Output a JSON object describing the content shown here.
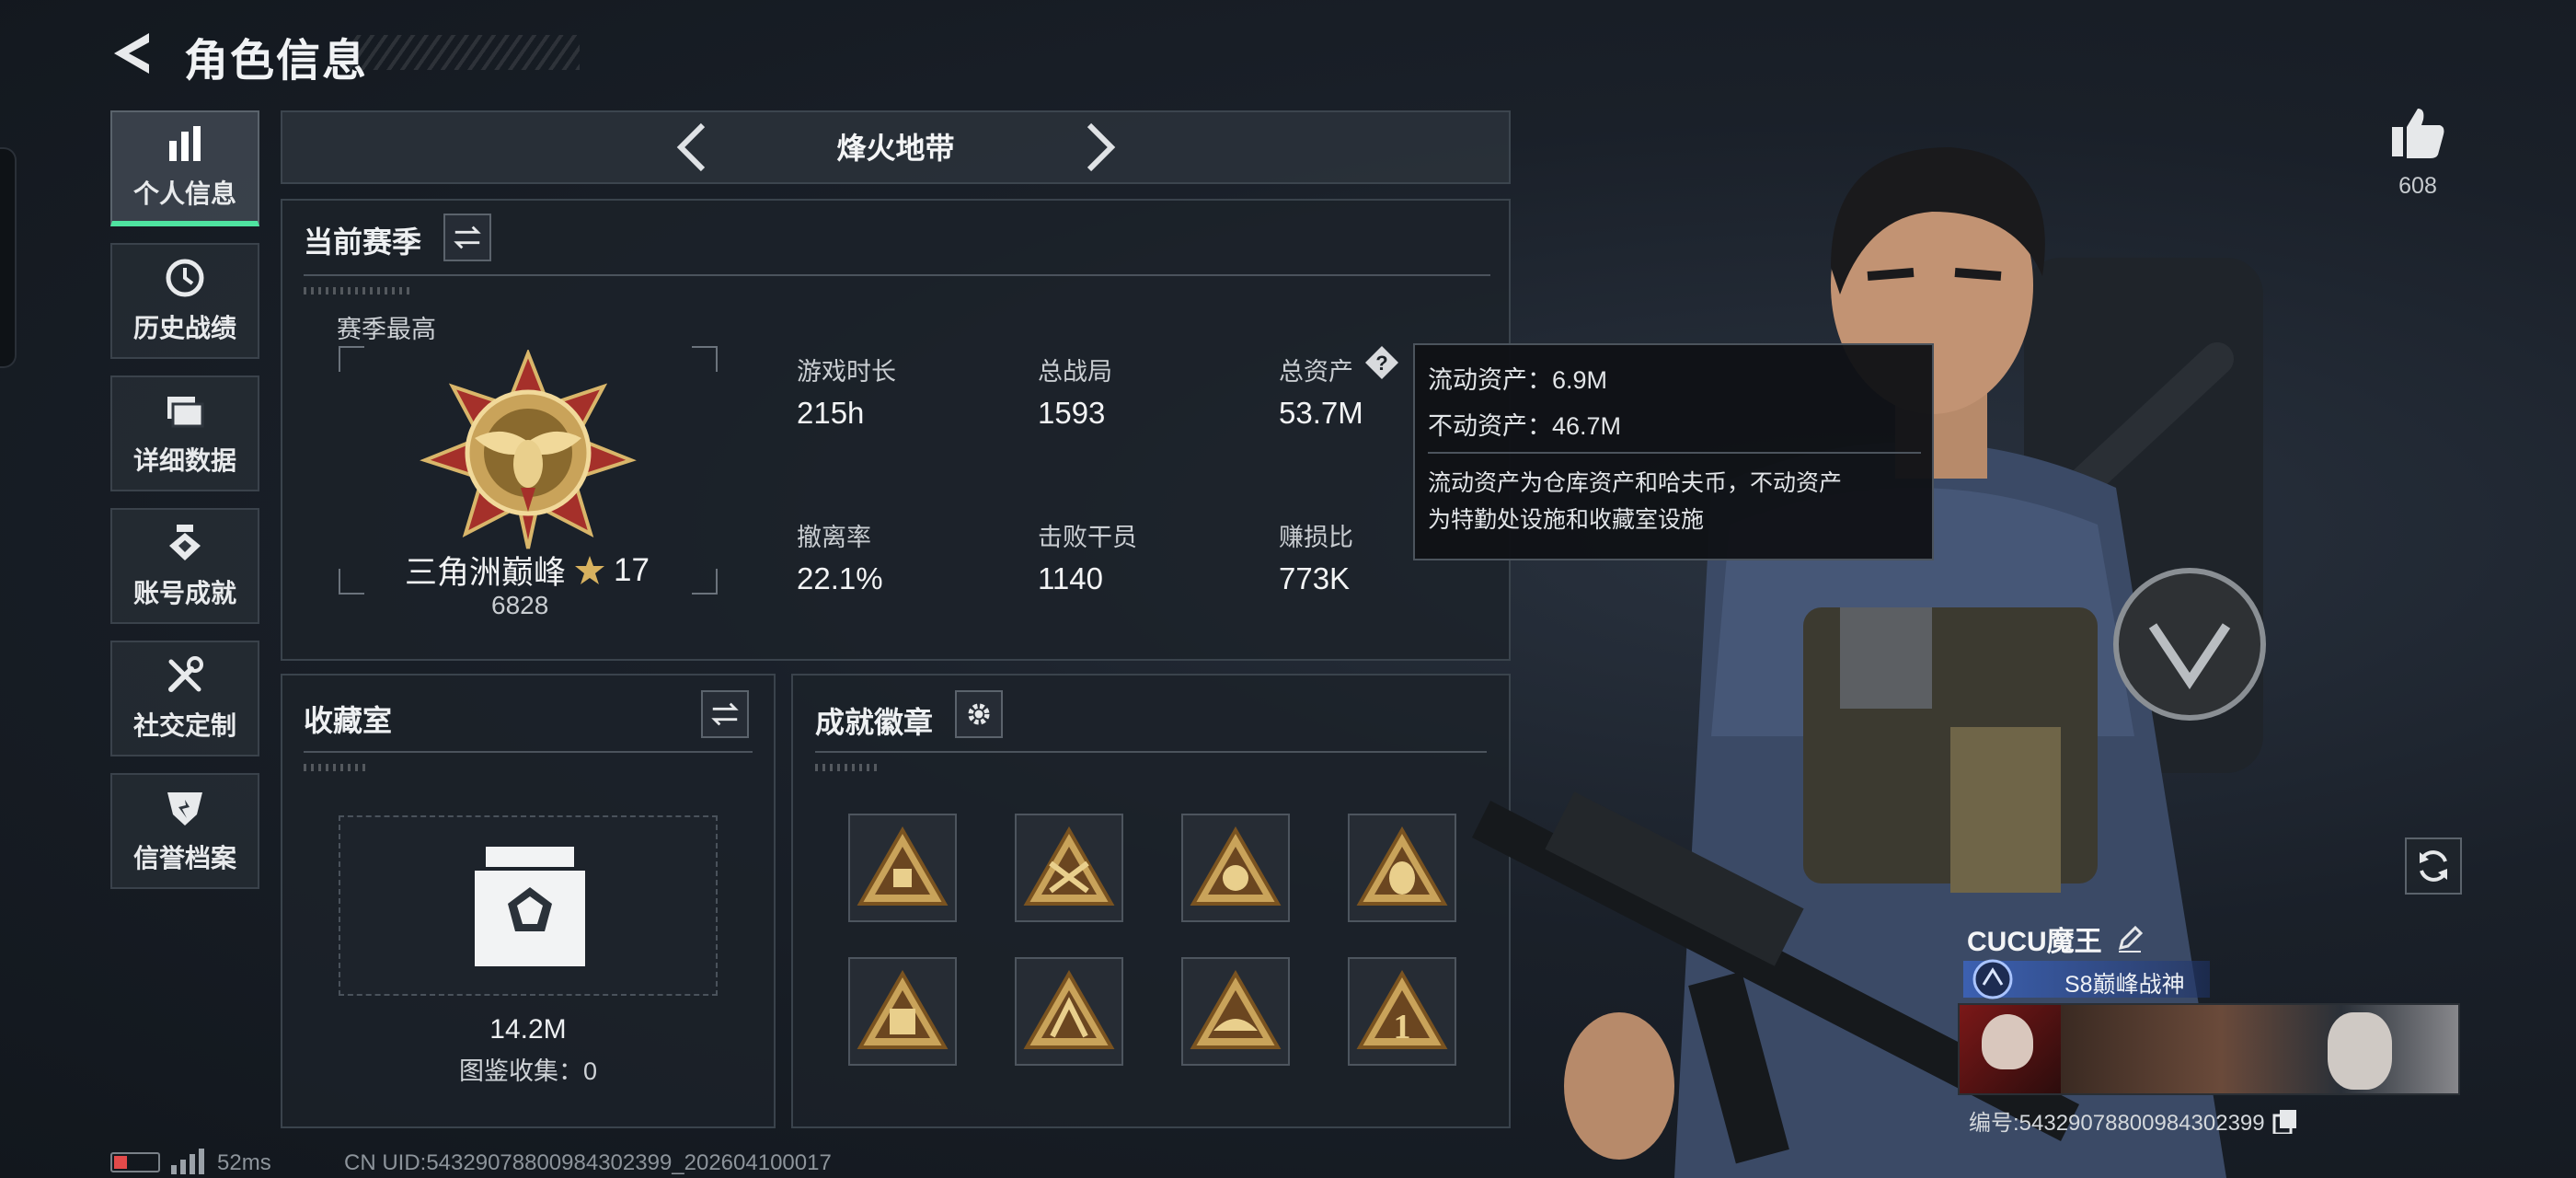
{
  "header": {
    "title": "角色信息"
  },
  "sidebar": {
    "items": [
      {
        "label": "个人信息",
        "icon": "bar-chart-icon",
        "active": true
      },
      {
        "label": "历史战绩",
        "icon": "history-icon",
        "active": false
      },
      {
        "label": "详细数据",
        "icon": "folder-icon",
        "active": false
      },
      {
        "label": "账号成就",
        "icon": "achievement-icon",
        "active": false
      },
      {
        "label": "社交定制",
        "icon": "tools-icon",
        "active": false
      },
      {
        "label": "信誉档案",
        "icon": "shield-icon",
        "active": false
      }
    ]
  },
  "mode_selector": {
    "title": "烽火地带"
  },
  "season": {
    "title": "当前赛季",
    "best_label": "赛季最高",
    "rank_name": "三角洲巅峰",
    "rank_stars": "17",
    "rank_points": "6828",
    "stats": [
      {
        "label": "游戏时长",
        "value": "215h"
      },
      {
        "label": "总战局",
        "value": "1593"
      },
      {
        "label": "总资产",
        "value": "53.7M"
      },
      {
        "label": "撤离率",
        "value": "22.1%"
      },
      {
        "label": "击败干员",
        "value": "1140"
      },
      {
        "label": "赚损比",
        "value": "773K"
      }
    ]
  },
  "tooltip": {
    "liquid": "流动资产：6.9M",
    "fixed": "不动资产：46.7M",
    "note_line1": "流动资产为仓库资产和哈夫币，不动资产",
    "note_line2": "为特勤处设施和收藏室设施"
  },
  "collection": {
    "title": "收藏室",
    "value": "14.2M",
    "catalog": "图鉴收集：0"
  },
  "achievements": {
    "title": "成就徽章",
    "badges": [
      "medal-1",
      "medal-2",
      "medal-s4",
      "medal-s5",
      "medal-s8",
      "medal-6",
      "medal-7",
      "medal-1st"
    ]
  },
  "likes": {
    "count": "608"
  },
  "player": {
    "name": "CUCU魔王",
    "title": "S8巅峰战神",
    "id_label": "编号:5432907880098430​2399"
  },
  "footer": {
    "ping": "52ms",
    "uid": "CN UID:54329078800984302399_202604100017"
  },
  "colors": {
    "accent_green": "#4ee3a0",
    "gold": "#c9a35a"
  }
}
